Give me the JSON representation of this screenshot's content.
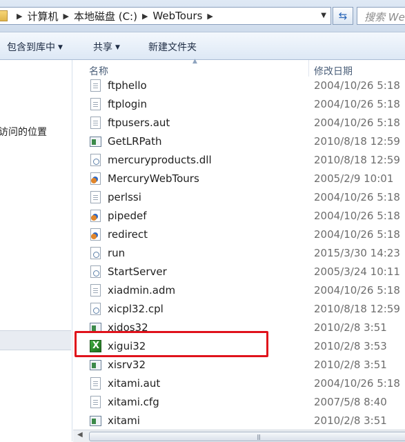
{
  "address": {
    "crumbs": [
      "计算机",
      "本地磁盘 (C:)",
      "WebTours"
    ],
    "search_placeholder": "搜索 We"
  },
  "toolbar": {
    "include_library": "包含到库中",
    "share": "共享",
    "new_folder": "新建文件夹"
  },
  "nav": {
    "item_recent": "访问的位置"
  },
  "columns": {
    "name": "名称",
    "modified": "修改日期"
  },
  "files": [
    {
      "name": "ftphello",
      "date": "2004/10/26 5:18",
      "icon": "text-file-icon"
    },
    {
      "name": "ftplogin",
      "date": "2004/10/26 5:18",
      "icon": "text-file-icon"
    },
    {
      "name": "ftpusers.aut",
      "date": "2004/10/26 5:18",
      "icon": "text-file-icon"
    },
    {
      "name": "GetLRPath",
      "date": "2010/8/18 12:59",
      "icon": "application-icon"
    },
    {
      "name": "mercuryproducts.dll",
      "date": "2010/8/18 12:59",
      "icon": "dll-file-icon"
    },
    {
      "name": "MercuryWebTours",
      "date": "2005/2/9 10:01",
      "icon": "web-file-icon"
    },
    {
      "name": "perlssi",
      "date": "2004/10/26 5:18",
      "icon": "text-file-icon"
    },
    {
      "name": "pipedef",
      "date": "2004/10/26 5:18",
      "icon": "web-file-icon"
    },
    {
      "name": "redirect",
      "date": "2004/10/26 5:18",
      "icon": "web-file-icon"
    },
    {
      "name": "run",
      "date": "2015/3/30 14:23",
      "icon": "dll-file-icon"
    },
    {
      "name": "StartServer",
      "date": "2005/3/24 10:11",
      "icon": "dll-file-icon"
    },
    {
      "name": "xiadmin.adm",
      "date": "2004/10/26 5:18",
      "icon": "text-file-icon"
    },
    {
      "name": "xicpl32.cpl",
      "date": "2010/8/18 12:59",
      "icon": "dll-file-icon"
    },
    {
      "name": "xidos32",
      "date": "2010/2/8 3:51",
      "icon": "application-icon"
    },
    {
      "name": "xigui32",
      "date": "2010/2/8 3:53",
      "icon": "xitami-x-icon"
    },
    {
      "name": "xisrv32",
      "date": "2010/2/8 3:51",
      "icon": "application-icon"
    },
    {
      "name": "xitami.aut",
      "date": "2004/10/26 5:18",
      "icon": "text-file-icon"
    },
    {
      "name": "xitami.cfg",
      "date": "2007/5/8 8:40",
      "icon": "text-file-icon"
    },
    {
      "name": "xitami",
      "date": "2010/2/8 3:51",
      "icon": "application-icon"
    }
  ],
  "highlight_color": "#e0121b"
}
